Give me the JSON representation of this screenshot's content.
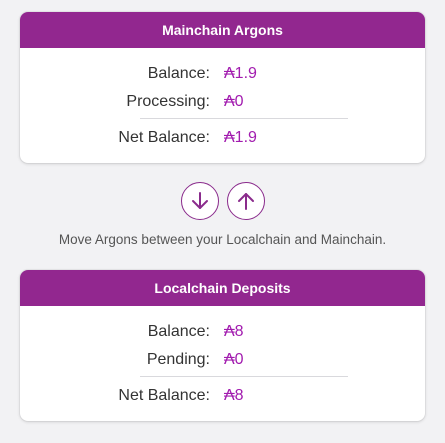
{
  "mainchain": {
    "title": "Mainchain Argons",
    "rows": [
      {
        "label": "Balance:",
        "value": "₳1.9"
      },
      {
        "label": "Processing:",
        "value": "₳0"
      },
      {
        "label": "Net Balance:",
        "value": "₳1.9"
      }
    ]
  },
  "transfer": {
    "down_icon": "arrow-down-icon",
    "up_icon": "arrow-up-icon",
    "hint": "Move Argons between your Localchain and Mainchain."
  },
  "localchain": {
    "title": "Localchain Deposits",
    "rows": [
      {
        "label": "Balance:",
        "value": "₳8"
      },
      {
        "label": "Pending:",
        "value": "₳0"
      },
      {
        "label": "Net Balance:",
        "value": "₳8"
      }
    ]
  },
  "colors": {
    "header_bg": "#92278f",
    "value_text": "#a21caf",
    "page_bg": "#f2f2f4"
  }
}
